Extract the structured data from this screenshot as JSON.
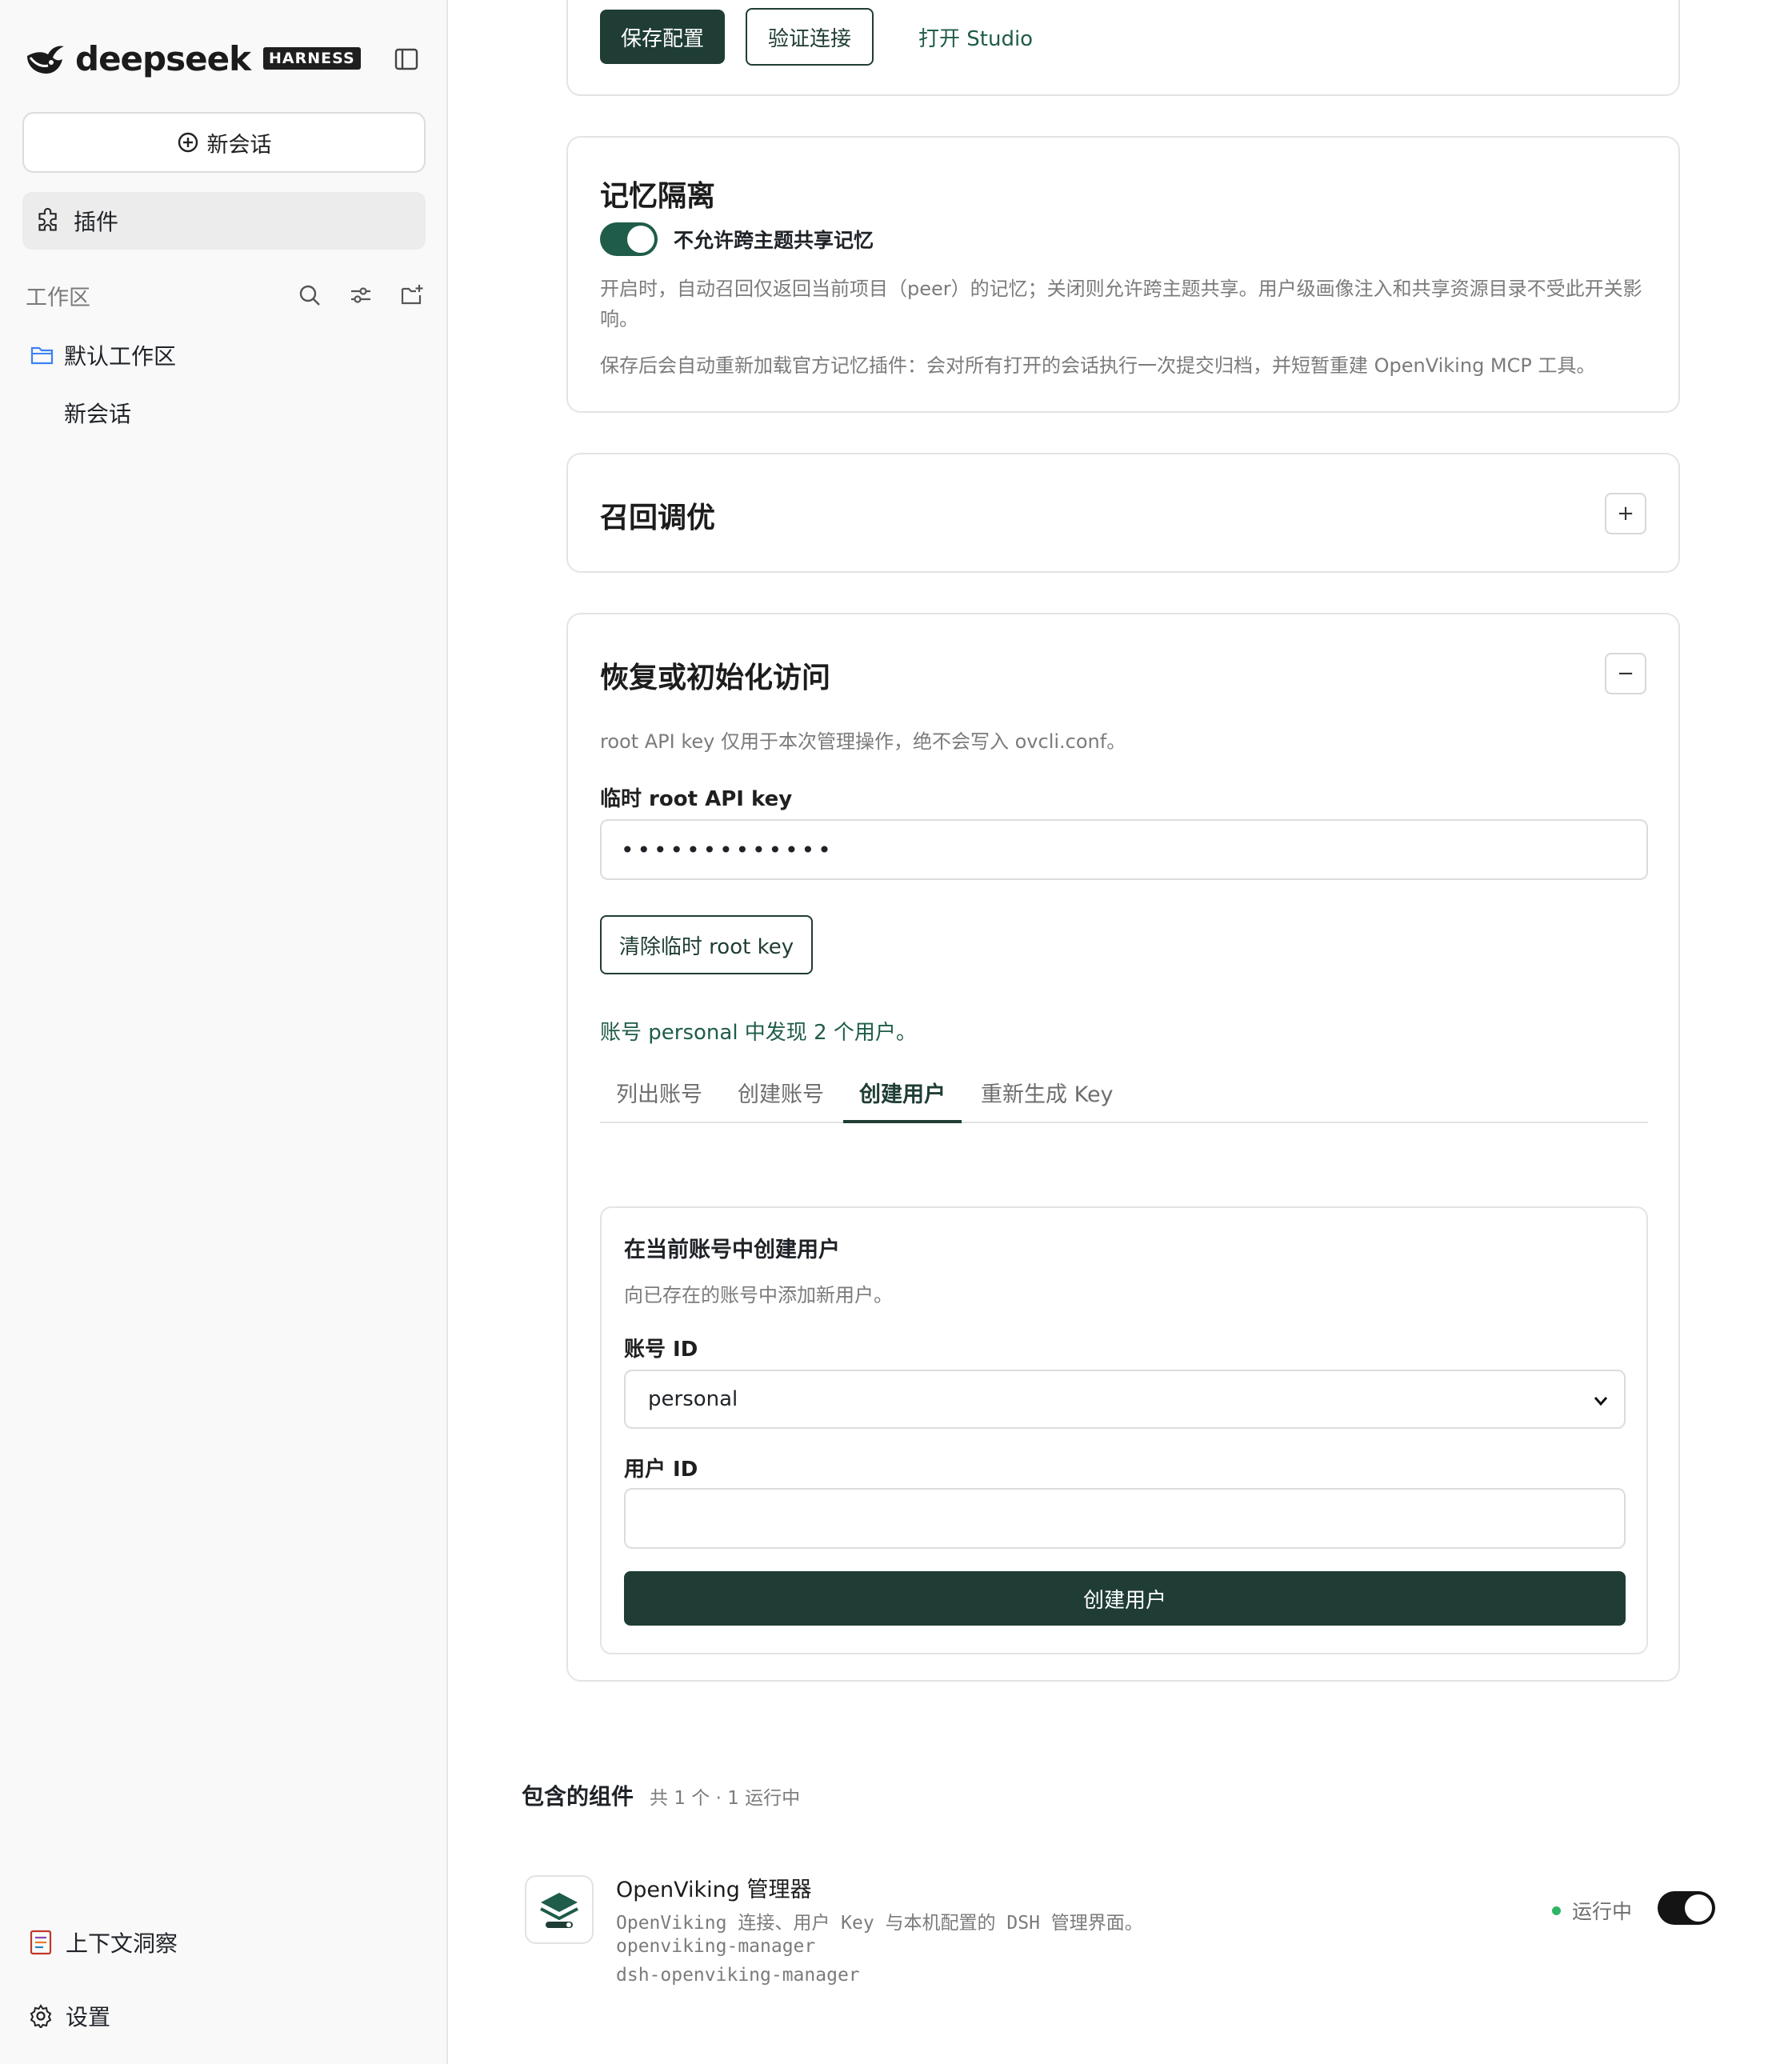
{
  "sidebar": {
    "brand_name": "deepseek",
    "brand_badge": "HARNESS",
    "new_chat_label": "新会话",
    "plugins_label": "插件",
    "workspace_title": "工作区",
    "folder_label": "默认工作区",
    "chat_item_label": "新会话",
    "context_label": "上下文洞察",
    "settings_label": "设置"
  },
  "top_actions": {
    "save_label": "保存配置",
    "verify_label": "验证连接",
    "studio_label": "打开 Studio"
  },
  "memory": {
    "title": "记忆隔离",
    "toggle_label": "不允许跨主题共享记忆",
    "toggle_on": true,
    "desc1": "开启时，自动召回仅返回当前项目（peer）的记忆；关闭则允许跨主题共享。用户级画像注入和共享资源目录不受此开关影响。",
    "desc2": "保存后会自动重新加载官方记忆插件：会对所有打开的会话执行一次提交归档，并短暂重建 OpenViking MCP 工具。"
  },
  "recall": {
    "title": "召回调优",
    "expand_symbol": "+"
  },
  "recovery": {
    "title": "恢复或初始化访问",
    "collapse_symbol": "−",
    "note": "root API key 仅用于本次管理操作，绝不会写入 ovcli.conf。",
    "key_label": "临时 root API key",
    "key_value": "•••••••••••••",
    "clear_label": "清除临时 root key",
    "found_text": "账号 personal 中发现 2 个用户。",
    "tabs": [
      "列出账号",
      "创建账号",
      "创建用户",
      "重新生成 Key"
    ],
    "active_tab": "创建用户",
    "form": {
      "title": "在当前账号中创建用户",
      "subtitle": "向已存在的账号中添加新用户。",
      "account_label": "账号 ID",
      "account_value": "personal",
      "user_label": "用户 ID",
      "user_value": "",
      "submit_label": "创建用户"
    }
  },
  "components": {
    "title": "包含的组件",
    "summary": "共 1 个 · 1 运行中",
    "item": {
      "name": "OpenViking 管理器",
      "desc": "OpenViking 连接、用户 Key 与本机配置的 DSH 管理界面。",
      "id1": "openviking-manager",
      "id2": "dsh-openviking-manager",
      "status": "运行中",
      "enabled": true
    }
  },
  "colors": {
    "accent": "#1f3d35",
    "toggle": "#1f5c4a",
    "status_dot": "#2fb567"
  },
  "icons": [
    "whale-logo-icon",
    "sidebar-toggle-icon",
    "plus-circle-icon",
    "puzzle-icon",
    "search-icon",
    "sliders-icon",
    "new-folder-icon",
    "folder-icon",
    "context-report-icon",
    "gear-icon",
    "stack-layers-icon",
    "chevron-down-icon"
  ]
}
